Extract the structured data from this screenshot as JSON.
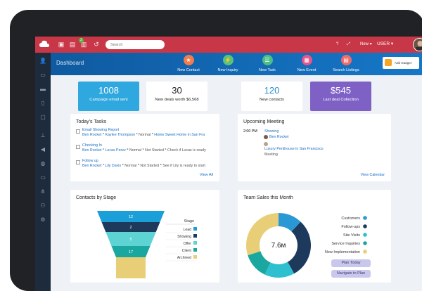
{
  "topbar": {
    "search_placeholder": "Search",
    "new_label": "New",
    "user_label": "USER",
    "badge": "2"
  },
  "header": {
    "title": "Dashboard",
    "actions": [
      {
        "label": "New Contact",
        "color": "#f47b4b",
        "icon": "star-icon",
        "glyph": "★"
      },
      {
        "label": "New Inquiry",
        "color": "#5cc17a",
        "icon": "bolt-icon",
        "glyph": "⚡"
      },
      {
        "label": "New Task",
        "color": "#4cbf84",
        "icon": "checklist-icon",
        "glyph": "☰"
      },
      {
        "label": "New Event",
        "color": "#e8558b",
        "icon": "calendar-icon",
        "glyph": "▦"
      },
      {
        "label": "Search Listings",
        "color": "#f26b6b",
        "icon": "building-icon",
        "glyph": "▤"
      }
    ],
    "add_button": "Add Gadget"
  },
  "kpis": [
    {
      "value": "1008",
      "label": "Campaign email sent",
      "bg": "#2ea8df",
      "fg": "#ffffff"
    },
    {
      "value": "30",
      "label": "New deals worth $6,568",
      "bg": "#ffffff",
      "fg": "#222222"
    },
    {
      "value": "120",
      "label": "New contacts",
      "bg": "#ffffff",
      "fg": "#222222"
    },
    {
      "value": "$545",
      "label": "Last  deal Collection",
      "bg": "#7f61c6",
      "fg": "#ffffff"
    }
  ],
  "tasks": {
    "title": "Today's Tasks",
    "items": [
      {
        "title": "Email Showing Report",
        "person": "Ben Rocket",
        "contact": "Kaylee Thompson",
        "priority": "Normal",
        "detail": "Home Sweet Home in San Fra"
      },
      {
        "title": "Checking In",
        "person": "Ben Rocket",
        "contact": "Lucas Perez",
        "priority": "Normal",
        "status": "Not Started",
        "detail": "Check if Lucas is ready"
      },
      {
        "title": "Follow up",
        "person": "Ben Rocket",
        "contact": "Lily Davis",
        "priority": "Normal",
        "status": "Not Started",
        "detail": "See if Lily is ready to start"
      }
    ],
    "view_all": "View All"
  },
  "meeting": {
    "title": "Upcoming Meeting",
    "time": "2:00 PM",
    "type": "Showing",
    "person": "Ben Rocket",
    "place": "Luxury Penthouse in San Francisco",
    "kind": "Meeting",
    "view_calendar": "View Calendar"
  },
  "contacts_stage": {
    "title": "Contacts by Stage",
    "legend_title": "Stage"
  },
  "team_sales": {
    "title": "Team Sales this Month",
    "center": "7.6м",
    "plan_today": "Plan Today",
    "navigate": "Navigate to Plan"
  },
  "chart_data": [
    {
      "type": "funnel",
      "title": "Contacts by Stage",
      "legend_title": "Stage",
      "categories": [
        "Lead",
        "Showing",
        "Offer",
        "Client",
        "Archived"
      ],
      "values": [
        12,
        2,
        5,
        17,
        null
      ],
      "colors": [
        "#1b9fd8",
        "#1d3a5c",
        "#5ed3d3",
        "#1aa7a0",
        "#e8cf77"
      ],
      "legend_placement": "right"
    },
    {
      "type": "pie",
      "title": "Team Sales this Month",
      "center_label": "7.6м",
      "categories": [
        "Customers",
        "Follow-ups",
        "Site Visits",
        "Service Inquiries",
        "New Implementation"
      ],
      "values": [
        12,
        30,
        15,
        13,
        30
      ],
      "colors": [
        "#2b98d6",
        "#1d3a5c",
        "#2fc0cf",
        "#1aa7a0",
        "#e8cf77"
      ],
      "legend_placement": "right"
    }
  ]
}
